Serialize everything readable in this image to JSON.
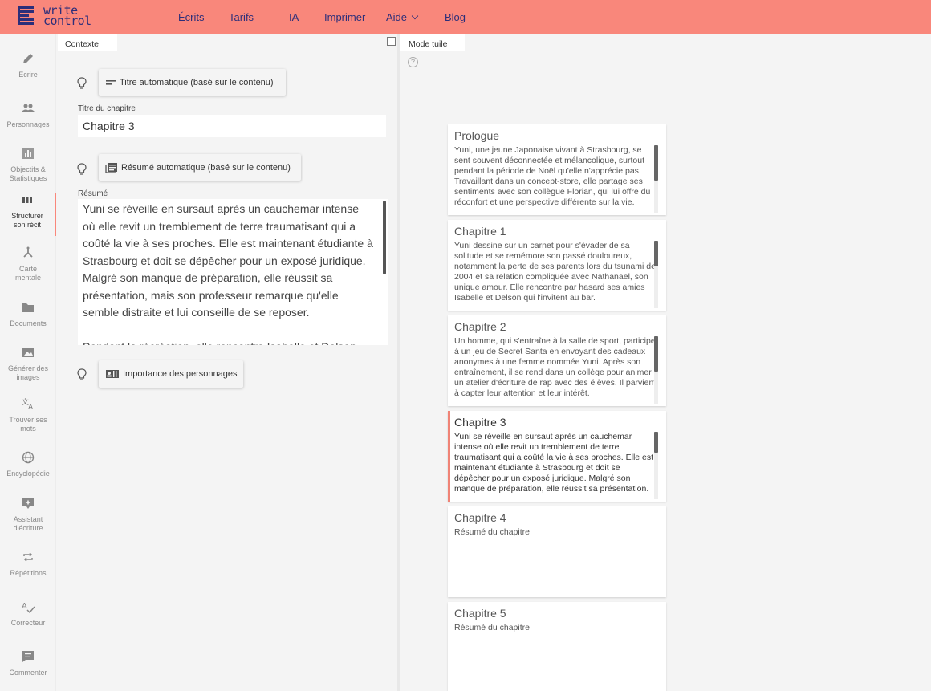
{
  "brand": {
    "line1": "write",
    "line2": "control",
    "accent": "#f9877b",
    "navy": "#2c2e7a"
  },
  "nav": [
    {
      "label": "Écrits",
      "active": true
    },
    {
      "label": "Tarifs"
    },
    {
      "label": "IA"
    },
    {
      "label": "Imprimer"
    },
    {
      "label": "Aide"
    },
    {
      "label": "Blog"
    }
  ],
  "sidebar": {
    "items": [
      {
        "label": "Écrire",
        "icon": "pencil-icon"
      },
      {
        "label": "Personnages",
        "icon": "people-icon"
      },
      {
        "label_line1": "Objectifs &",
        "label_line2": "Statistiques",
        "icon": "bar-chart-icon"
      },
      {
        "label_line1": "Structurer",
        "label_line2": "son récit",
        "icon": "columns-icon",
        "active": true
      },
      {
        "label_line1": "Carte",
        "label_line2": "mentale",
        "icon": "mind-map-icon"
      },
      {
        "label": "Documents",
        "icon": "folder-icon"
      },
      {
        "label_line1": "Générer des",
        "label_line2": "images",
        "icon": "image-icon"
      },
      {
        "label_line1": "Trouver ses",
        "label_line2": "mots",
        "icon": "translate-icon"
      },
      {
        "label": "Encyclopédie",
        "icon": "globe-icon"
      },
      {
        "label_line1": "Assistant",
        "label_line2": "d'écriture",
        "icon": "assistant-icon"
      },
      {
        "label": "Répétitions",
        "icon": "repeat-icon"
      },
      {
        "label": "Correcteur",
        "icon": "spellcheck-icon"
      },
      {
        "label": "Commenter",
        "icon": "comment-icon"
      }
    ]
  },
  "context": {
    "tab_label": "Contexte",
    "auto_title_button": "Titre automatique (basé sur le contenu)",
    "title_label": "Titre du chapitre",
    "title_value": "Chapitre 3",
    "auto_summary_button": "Résumé automatique (basé sur le contenu)",
    "summary_label": "Résumé",
    "summary_p1": "Yuni se réveille en sursaut après un cauchemar intense où elle revit un tremblement de terre traumatisant qui a coûté la vie à ses proches. Elle est maintenant étudiante à Strasbourg et doit se dépêcher pour un exposé juridique. Malgré son manque de préparation, elle réussit sa présentation, mais son professeur remarque qu'elle semble distraite et lui conseille de se reposer.",
    "summary_p2": "Pendant la récréation, elle rencontre Isabelle et Delson. Yuni",
    "importance_button": "Importance des personnages"
  },
  "tiles": {
    "tab_label": "Mode tuile",
    "help_glyph": "?",
    "chapters": [
      {
        "title": "Prologue",
        "summary": "Yuni, une jeune Japonaise vivant à Strasbourg, se sent souvent déconnectée et mélancolique, surtout pendant la période de Noël qu'elle n'apprécie pas. Travaillant dans un concept-store, elle partage ses sentiments avec son collègue Florian, qui lui offre du réconfort et une perspective différente sur la vie."
      },
      {
        "title": "Chapitre 1",
        "summary": "Yuni dessine sur un carnet pour s'évader de sa solitude et se remémore son passé douloureux, notamment la perte de ses parents lors du tsunami de 2004 et sa relation compliquée avec Nathanaël, son unique amour. Elle rencontre par hasard ses amies Isabelle et Delson qui l'invitent au bar."
      },
      {
        "title": "Chapitre 2",
        "summary": "Un homme, qui s'entraîne à la salle de sport, participe à un jeu de Secret Santa en envoyant des cadeaux anonymes à une femme nommée Yuni. Après son entraînement, il se rend dans un collège pour animer un atelier d'écriture de rap avec des élèves. Il parvient à capter leur attention et leur intérêt."
      },
      {
        "title": "Chapitre 3",
        "summary": "Yuni se réveille en sursaut après un cauchemar intense où elle revit un tremblement de terre traumatisant qui a coûté la vie à ses proches. Elle est maintenant étudiante à Strasbourg et doit se dépêcher pour un exposé juridique. Malgré son manque de préparation, elle réussit sa présentation.",
        "selected": true
      },
      {
        "title": "Chapitre 4",
        "summary": "Résumé du chapitre"
      },
      {
        "title": "Chapitre 5",
        "summary": "Résumé du chapitre"
      }
    ]
  }
}
